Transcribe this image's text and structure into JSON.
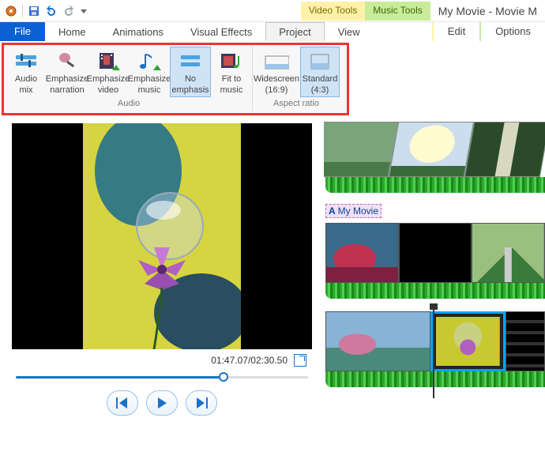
{
  "app_title": "My Movie - Movie M",
  "context_tabs": {
    "video": "Video Tools",
    "music": "Music Tools",
    "edit": "Edit",
    "options": "Options"
  },
  "menu": {
    "file": "File",
    "home": "Home",
    "animations": "Animations",
    "visual_effects": "Visual Effects",
    "project": "Project",
    "view": "View"
  },
  "ribbon": {
    "audio": {
      "label": "Audio",
      "mix_l1": "Audio",
      "mix_l2": "mix",
      "narr_l1": "Emphasize",
      "narr_l2": "narration",
      "vid_l1": "Emphasize",
      "vid_l2": "video",
      "mus_l1": "Emphasize",
      "mus_l2": "music",
      "none_l1": "No",
      "none_l2": "emphasis",
      "fit_l1": "Fit to",
      "fit_l2": "music"
    },
    "aspect": {
      "label": "Aspect ratio",
      "wide_l1": "Widescreen",
      "wide_l2": "(16:9)",
      "std_l1": "Standard",
      "std_l2": "(4:3)"
    }
  },
  "player": {
    "elapsed": "01:47.07",
    "total": "02:30.50",
    "progress_pct": 71
  },
  "timeline": {
    "caption_text": "My Movie"
  },
  "colors": {
    "accent": "#1a72c8",
    "highlight": "#e33",
    "ctx_video": "#fff2a8",
    "ctx_music": "#c8ec9a"
  }
}
